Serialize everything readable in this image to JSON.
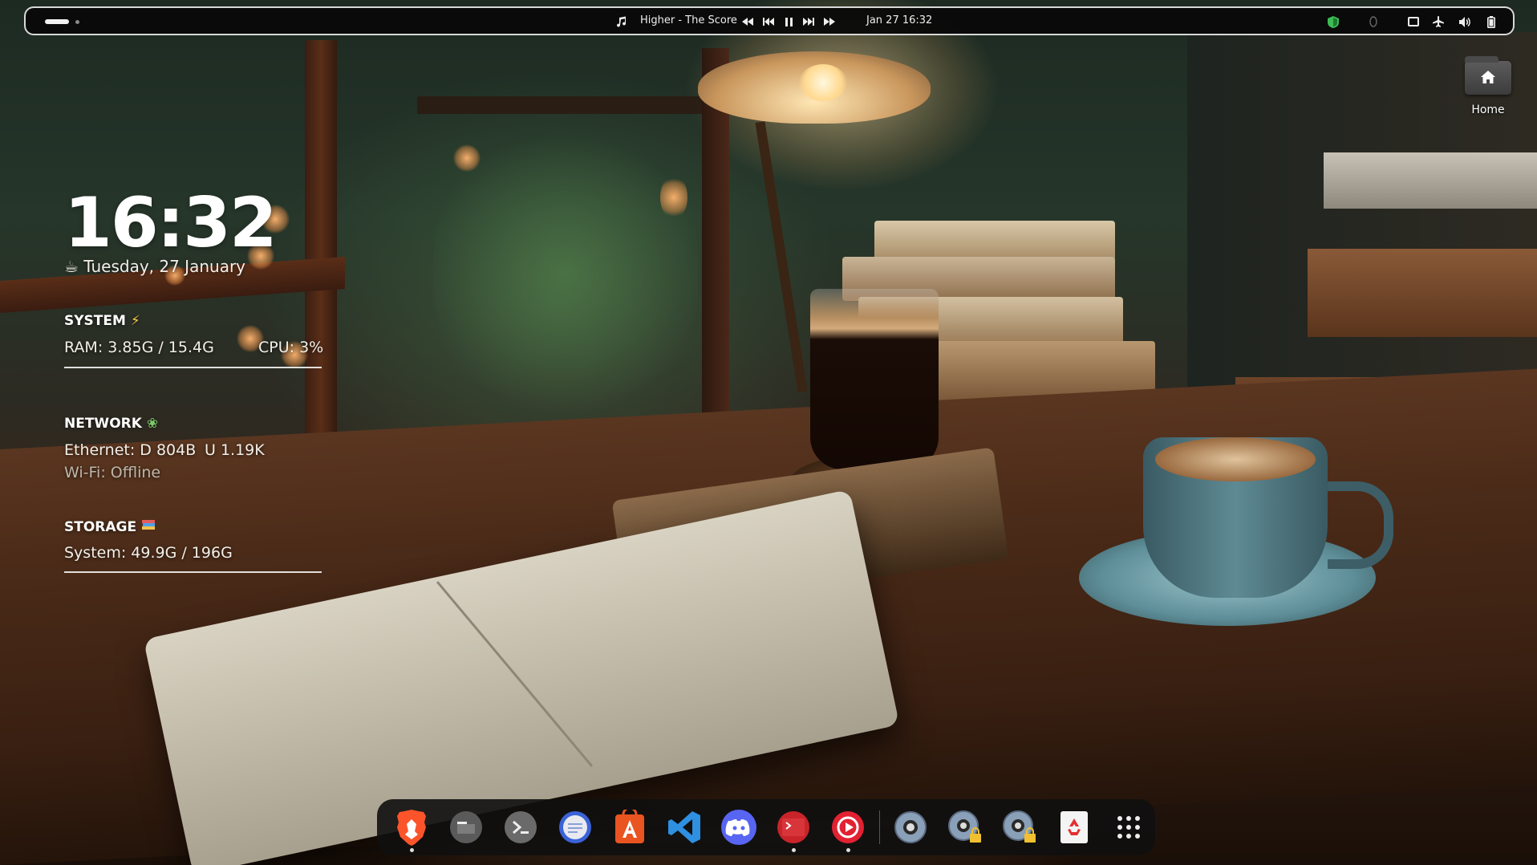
{
  "topbar": {
    "media": {
      "title": "Higher - The Score",
      "icon": "music-note-icon"
    },
    "datetime": "Jan 27  16:32",
    "tray_icons": [
      "shield-icon",
      "circle-status-icon",
      "screen-icon",
      "airplane-icon",
      "volume-icon",
      "battery-icon"
    ]
  },
  "desktop": {
    "clock": {
      "time": "16:32",
      "date": "Tuesday, 27 January",
      "date_icon": "coffee-icon"
    },
    "system": {
      "title": "SYSTEM",
      "ram": "RAM: 3.85G / 15.4G",
      "cpu": "CPU: 3%"
    },
    "network": {
      "title": "NETWORK",
      "ethernet": "Ethernet: D 804B",
      "upload": "U 1.19K",
      "wifi": "Wi-Fi: Offline"
    },
    "storage": {
      "title": "STORAGE",
      "system": "System: 49.9G / 196G"
    },
    "home_icon": {
      "label": "Home"
    }
  },
  "dock": {
    "apps": [
      {
        "name": "brave-browser-icon",
        "running": true
      },
      {
        "name": "files-icon",
        "running": false
      },
      {
        "name": "terminal-icon",
        "running": false
      },
      {
        "name": "messages-icon",
        "running": false
      },
      {
        "name": "app-center-icon",
        "running": false
      },
      {
        "name": "vscode-icon",
        "running": false
      },
      {
        "name": "discord-icon",
        "running": false
      },
      {
        "name": "ssh-client-icon",
        "running": true
      },
      {
        "name": "media-player-icon",
        "running": true
      },
      {
        "name": "disc-icon",
        "running": false
      },
      {
        "name": "disc-locked-icon-1",
        "running": false
      },
      {
        "name": "disc-locked-icon-2",
        "running": false
      },
      {
        "name": "trash-icon",
        "running": false
      },
      {
        "name": "app-grid-icon",
        "running": false
      }
    ]
  },
  "colors": {
    "accent_vscode": "#2f8fe0",
    "accent_discord": "#5865f2",
    "accent_app_center": "#e95420",
    "accent_brave": "#fb542b"
  }
}
